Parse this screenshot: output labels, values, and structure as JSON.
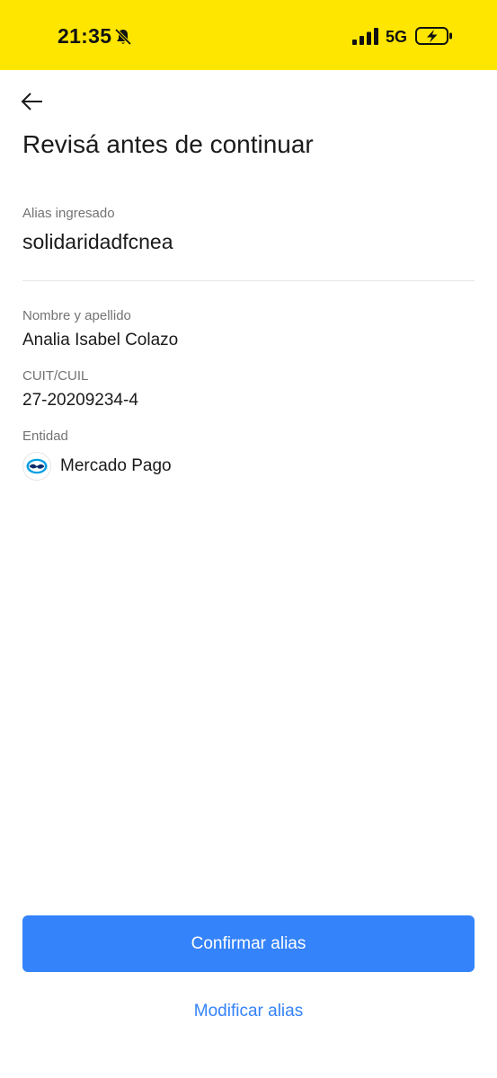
{
  "status_bar": {
    "time": "21:35",
    "network": "5G",
    "icons": [
      "bell-slash-icon",
      "signal-icon",
      "battery-charging-icon"
    ],
    "background": "#ffe600"
  },
  "header": {
    "back_icon": "arrow-left-icon",
    "title": "Revisá antes de continuar"
  },
  "alias": {
    "label": "Alias ingresado",
    "value": "solidaridadfcnea"
  },
  "details": {
    "name_label": "Nombre y apellido",
    "name_value": "Analia Isabel Colazo",
    "cuit_label": "CUIT/CUIL",
    "cuit_value": "27-20209234-4",
    "entity_label": "Entidad",
    "entity_value": "Mercado Pago",
    "entity_icon": "mercado-pago-logo-icon"
  },
  "actions": {
    "confirm_label": "Confirmar alias",
    "modify_label": "Modificar alias",
    "accent": "#3483fa"
  }
}
